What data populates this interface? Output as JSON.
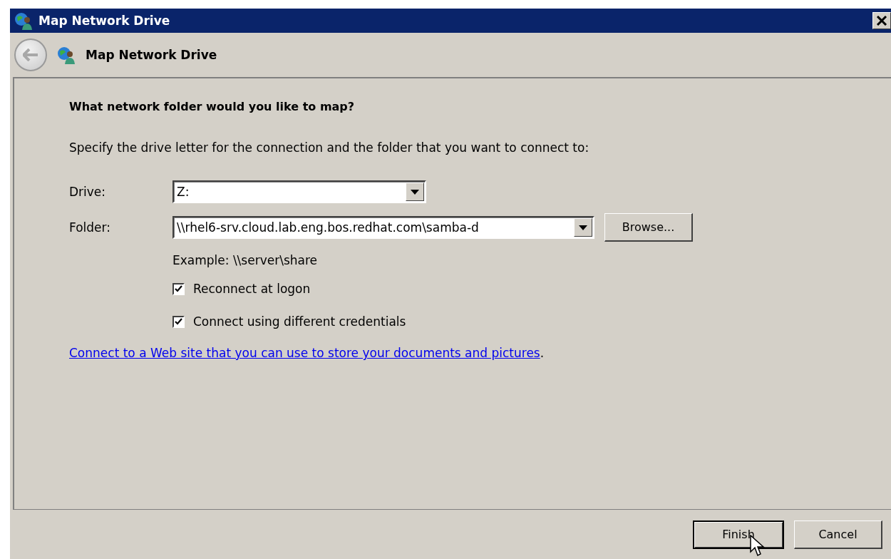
{
  "window": {
    "title": "Map Network Drive"
  },
  "header": {
    "title": "Map Network Drive"
  },
  "heading": "What network folder would you like to map?",
  "instruction": "Specify the drive letter for the connection and the folder that you want to connect to:",
  "fields": [
    {
      "label": "Drive:",
      "value": "Z:"
    },
    {
      "label": "Folder:",
      "value": "\\\\rhel6-srv.cloud.lab.eng.bos.redhat.com\\samba-d"
    }
  ],
  "browse_button": "Browse...",
  "example": "Example: \\\\server\\share",
  "options": [
    {
      "label": "Reconnect at logon",
      "checked": true
    },
    {
      "label": "Connect using different credentials",
      "checked": true
    }
  ],
  "link": {
    "text": "Connect to a Web site that you can use to store your documents and pictures",
    "after": "."
  },
  "buttons": [
    {
      "label": "Finish",
      "default": true
    },
    {
      "label": "Cancel",
      "default": false
    }
  ]
}
